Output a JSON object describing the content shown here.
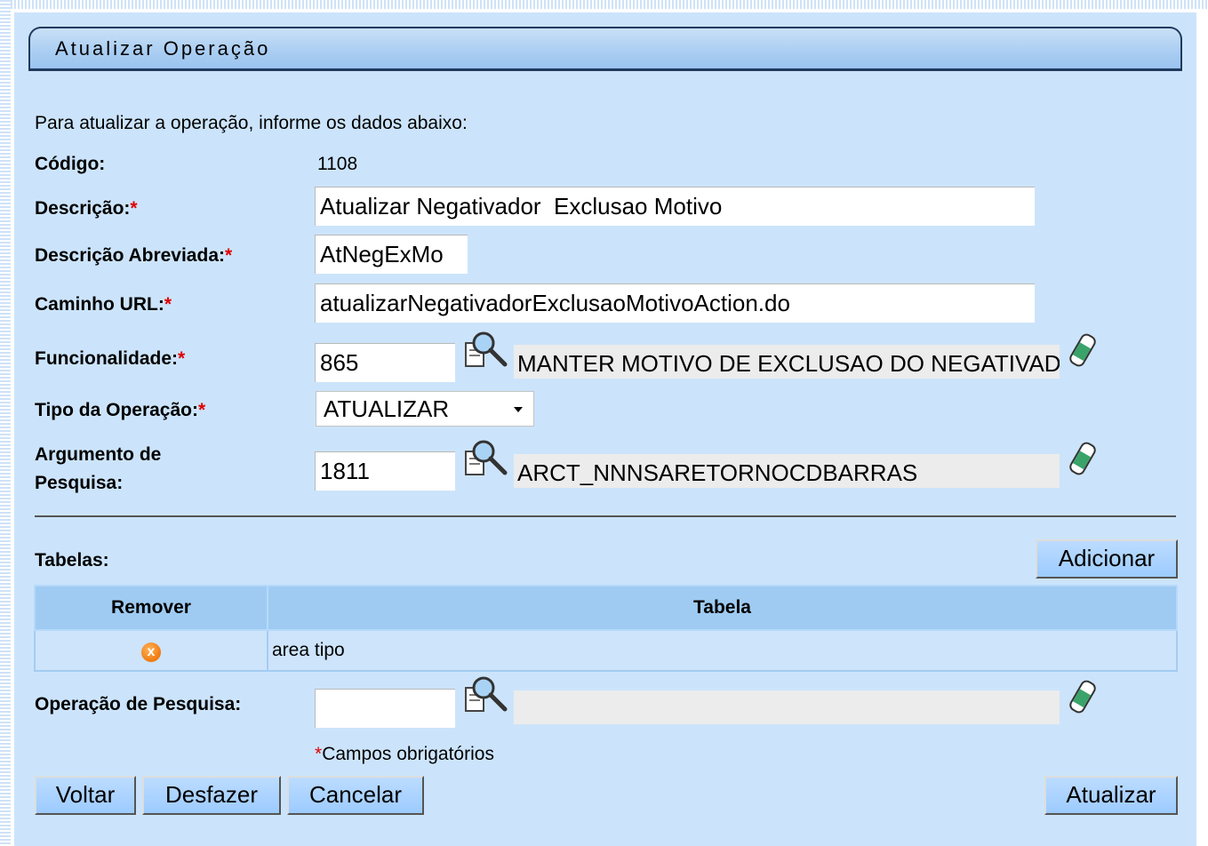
{
  "header": {
    "title": "Atualizar Operação"
  },
  "form": {
    "intro": "Para atualizar a operação, informe os dados abaixo:",
    "codigo": {
      "label": "Código:",
      "value": "1108"
    },
    "descricao": {
      "label": "Descrição:",
      "required": "*",
      "value": "Atualizar Negativador  Exclusao Motivo"
    },
    "descricao_abreviada": {
      "label": "Descrição Abreviada:",
      "required": "*",
      "value": "AtNegExMo"
    },
    "caminho_url": {
      "label": "Caminho URL:",
      "required": "*",
      "value": "atualizarNegativadorExclusaoMotivoAction.do"
    },
    "funcionalidade": {
      "label": "Funcionalidade:",
      "required": "*",
      "code": "865",
      "description": "MANTER MOTIVO DE EXCLUSAO DO NEGATIVADOR"
    },
    "tipo_operacao": {
      "label": "Tipo da Operação:",
      "required": "*",
      "selected": "ATUALIZAR"
    },
    "argumento_pesquisa": {
      "label_line1": "Argumento de",
      "label_line2": "Pesquisa:",
      "code": "1811",
      "description": "ARCT_NNNSARETORNOCDBARRAS"
    },
    "tabelas_label": "Tabelas:",
    "add_button": "Adicionar",
    "table": {
      "headers": [
        "Remover",
        "Tabela"
      ],
      "rows": [
        {
          "remove_icon": "x",
          "tabela": "area tipo"
        }
      ]
    },
    "operacao_pesquisa": {
      "label": "Operação de Pesquisa:",
      "code": "",
      "description": ""
    },
    "required_note_star": "*",
    "required_note": "Campos obrigatórios"
  },
  "buttons": {
    "voltar": "Voltar",
    "desfazer": "Desfazer",
    "cancelar": "Cancelar",
    "atualizar": "Atualizar"
  },
  "icons": {
    "search": "magnifier-icon",
    "clear": "eraser-icon",
    "remove": "remove-circle-icon"
  },
  "colors": {
    "panel_bg": "#cce4fb",
    "table_header_bg": "#9fcbf2",
    "required": "#e00000",
    "button_bg": "#9ccbff"
  }
}
